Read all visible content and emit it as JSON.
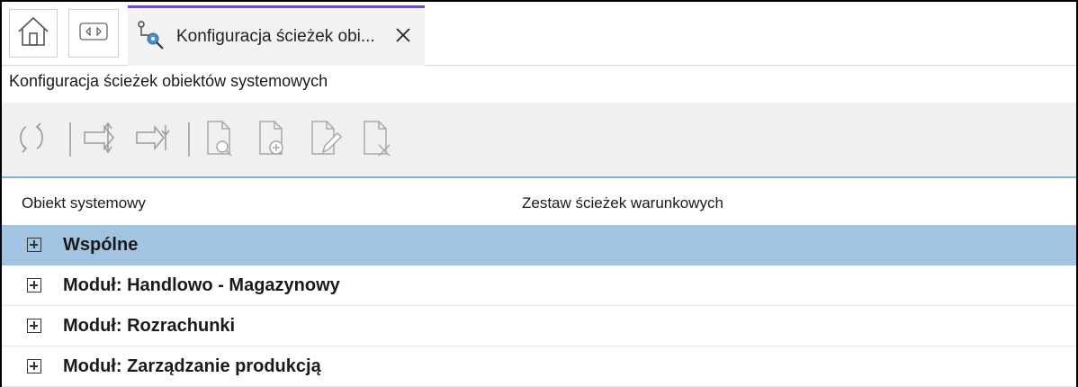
{
  "tabbar": {
    "home_icon": "home-icon",
    "nav_icon": "left-right-arrows-icon",
    "active_tab": {
      "icon": "path-config-icon",
      "title": "Konfiguracja ścieżek obi...",
      "close_icon": "close-icon"
    }
  },
  "page": {
    "title": "Konfiguracja ścieżek obiektów systemowych"
  },
  "toolbar": {
    "tools": [
      {
        "name": "refresh-icon"
      },
      {
        "name": "expand-all-icon"
      },
      {
        "name": "collapse-all-icon"
      },
      {
        "name": "document-preview-icon"
      },
      {
        "name": "document-add-icon"
      },
      {
        "name": "document-edit-icon"
      },
      {
        "name": "document-delete-icon"
      }
    ]
  },
  "grid": {
    "columns": [
      "Obiekt systemowy",
      "Zestaw ścieżek warunkowych"
    ],
    "rows": [
      {
        "label": "Wspólne",
        "selected": true
      },
      {
        "label": "Moduł: Handlowo - Magazynowy",
        "selected": false
      },
      {
        "label": "Moduł: Rozrachunki",
        "selected": false
      },
      {
        "label": "Moduł: Zarządzanie produkcją",
        "selected": false
      }
    ]
  },
  "colors": {
    "accent_tab": "#6b4fbb",
    "selected_row": "#a3c4e0",
    "toolbar_bg": "#f0f0f0",
    "toolbar_border": "#7fb5cf"
  }
}
